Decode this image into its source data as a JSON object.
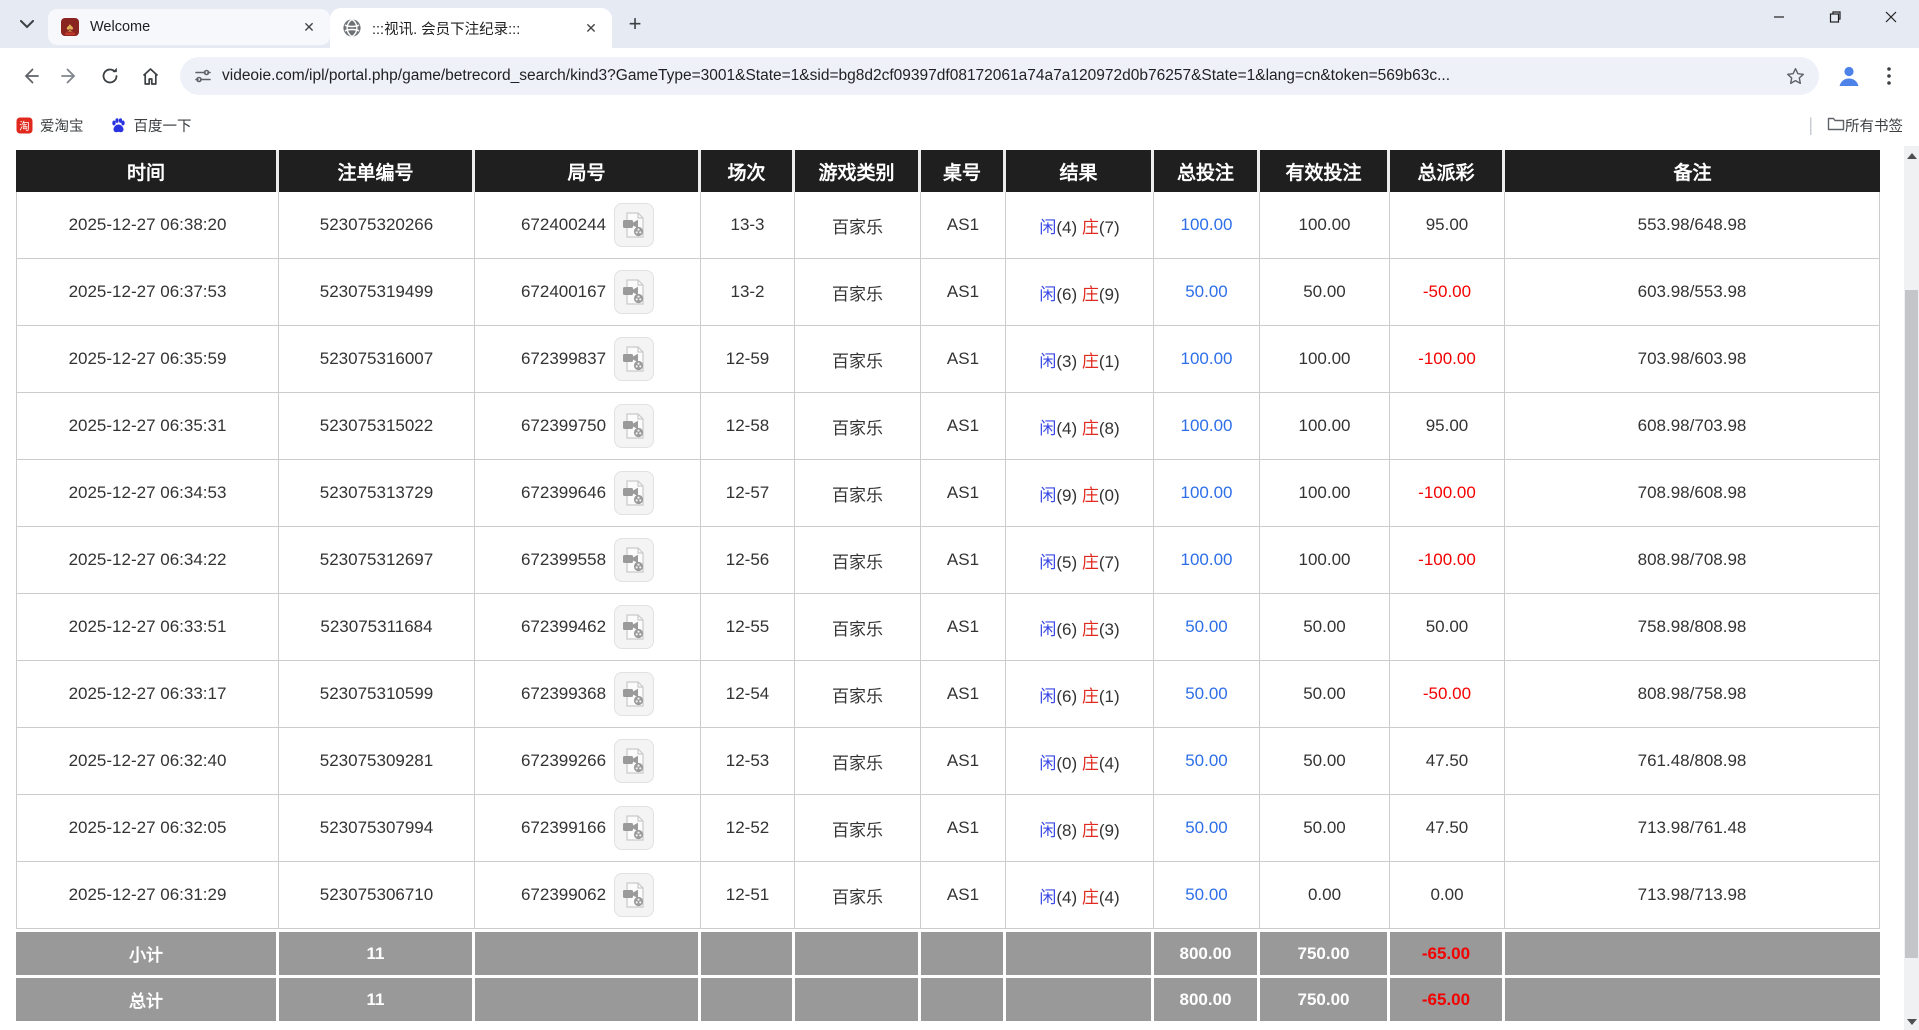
{
  "browser": {
    "tabs": [
      {
        "title": "Welcome"
      },
      {
        "title": ":::视讯. 会员下注纪录:::"
      }
    ],
    "url": "videoie.com/ipl/portal.php/game/betrecord_search/kind3?GameType=3001&State=1&sid=bg8d2cf09397df08172061a74a7a120972d0b76257&State=1&lang=cn&token=569b63c...",
    "bookmarks": {
      "items": [
        "爱淘宝",
        "百度一下"
      ],
      "all_bookmarks_label": "所有书签"
    }
  },
  "table": {
    "headers": [
      "时间",
      "注单编号",
      "局号",
      "场次",
      "游戏类别",
      "桌号",
      "结果",
      "总投注",
      "有效投注",
      "总派彩",
      "备注"
    ],
    "result_labels": {
      "player": "闲",
      "banker": "庄"
    },
    "rows": [
      {
        "time": "2025-12-27 06:38:20",
        "bet_id": "523075320266",
        "round_id": "672400244",
        "session": "13-3",
        "game": "百家乐",
        "table_no": "AS1",
        "player": "4",
        "banker": "7",
        "total_bet": "100.00",
        "valid_bet": "100.00",
        "payout": "95.00",
        "note": "553.98/648.98"
      },
      {
        "time": "2025-12-27 06:37:53",
        "bet_id": "523075319499",
        "round_id": "672400167",
        "session": "13-2",
        "game": "百家乐",
        "table_no": "AS1",
        "player": "6",
        "banker": "9",
        "total_bet": "50.00",
        "valid_bet": "50.00",
        "payout": "-50.00",
        "note": "603.98/553.98"
      },
      {
        "time": "2025-12-27 06:35:59",
        "bet_id": "523075316007",
        "round_id": "672399837",
        "session": "12-59",
        "game": "百家乐",
        "table_no": "AS1",
        "player": "3",
        "banker": "1",
        "total_bet": "100.00",
        "valid_bet": "100.00",
        "payout": "-100.00",
        "note": "703.98/603.98"
      },
      {
        "time": "2025-12-27 06:35:31",
        "bet_id": "523075315022",
        "round_id": "672399750",
        "session": "12-58",
        "game": "百家乐",
        "table_no": "AS1",
        "player": "4",
        "banker": "8",
        "total_bet": "100.00",
        "valid_bet": "100.00",
        "payout": "95.00",
        "note": "608.98/703.98"
      },
      {
        "time": "2025-12-27 06:34:53",
        "bet_id": "523075313729",
        "round_id": "672399646",
        "session": "12-57",
        "game": "百家乐",
        "table_no": "AS1",
        "player": "9",
        "banker": "0",
        "total_bet": "100.00",
        "valid_bet": "100.00",
        "payout": "-100.00",
        "note": "708.98/608.98"
      },
      {
        "time": "2025-12-27 06:34:22",
        "bet_id": "523075312697",
        "round_id": "672399558",
        "session": "12-56",
        "game": "百家乐",
        "table_no": "AS1",
        "player": "5",
        "banker": "7",
        "total_bet": "100.00",
        "valid_bet": "100.00",
        "payout": "-100.00",
        "note": "808.98/708.98"
      },
      {
        "time": "2025-12-27 06:33:51",
        "bet_id": "523075311684",
        "round_id": "672399462",
        "session": "12-55",
        "game": "百家乐",
        "table_no": "AS1",
        "player": "6",
        "banker": "3",
        "total_bet": "50.00",
        "valid_bet": "50.00",
        "payout": "50.00",
        "note": "758.98/808.98"
      },
      {
        "time": "2025-12-27 06:33:17",
        "bet_id": "523075310599",
        "round_id": "672399368",
        "session": "12-54",
        "game": "百家乐",
        "table_no": "AS1",
        "player": "6",
        "banker": "1",
        "total_bet": "50.00",
        "valid_bet": "50.00",
        "payout": "-50.00",
        "note": "808.98/758.98"
      },
      {
        "time": "2025-12-27 06:32:40",
        "bet_id": "523075309281",
        "round_id": "672399266",
        "session": "12-53",
        "game": "百家乐",
        "table_no": "AS1",
        "player": "0",
        "banker": "4",
        "total_bet": "50.00",
        "valid_bet": "50.00",
        "payout": "47.50",
        "note": "761.48/808.98"
      },
      {
        "time": "2025-12-27 06:32:05",
        "bet_id": "523075307994",
        "round_id": "672399166",
        "session": "12-52",
        "game": "百家乐",
        "table_no": "AS1",
        "player": "8",
        "banker": "9",
        "total_bet": "50.00",
        "valid_bet": "50.00",
        "payout": "47.50",
        "note": "713.98/761.48"
      },
      {
        "time": "2025-12-27 06:31:29",
        "bet_id": "523075306710",
        "round_id": "672399062",
        "session": "12-51",
        "game": "百家乐",
        "table_no": "AS1",
        "player": "4",
        "banker": "4",
        "total_bet": "50.00",
        "valid_bet": "0.00",
        "payout": "0.00",
        "note": "713.98/713.98"
      }
    ],
    "subtotal": {
      "label": "小计",
      "count": "11",
      "total_bet": "800.00",
      "valid_bet": "750.00",
      "payout": "-65.00"
    },
    "total": {
      "label": "总计",
      "count": "11",
      "total_bet": "800.00",
      "valid_bet": "750.00",
      "payout": "-65.00"
    }
  },
  "colors": {
    "link_blue": "#2e6fe8",
    "player_blue": "#3a49e6",
    "banker_red": "#e02a1e",
    "negative_red": "#f40000",
    "header_bg": "#1f1f1f",
    "footer_bg": "#999999"
  }
}
